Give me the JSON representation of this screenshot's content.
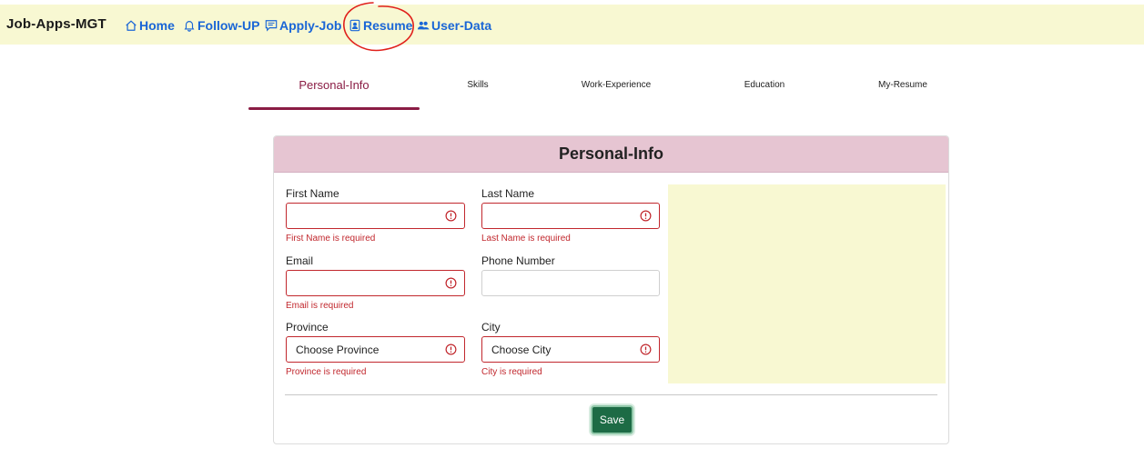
{
  "navbar": {
    "brand": "Job-Apps-MGT",
    "links": [
      {
        "label": "Home",
        "icon": "house-icon"
      },
      {
        "label": "Follow-UP",
        "icon": "bell-icon"
      },
      {
        "label": "Apply-Job",
        "icon": "chat-text-icon"
      },
      {
        "label": "Resume",
        "icon": "person-badge-icon"
      },
      {
        "label": "User-Data",
        "icon": "people-icon"
      }
    ],
    "link_color": "#1a66d6",
    "background": "#f8f8d2"
  },
  "annotation": {
    "color": "#e0201b",
    "target": "Resume"
  },
  "tabs": [
    {
      "label": "Personal-Info",
      "active": true
    },
    {
      "label": "Skills",
      "active": false
    },
    {
      "label": "Work-Experience",
      "active": false
    },
    {
      "label": "Education",
      "active": false
    },
    {
      "label": "My-Resume",
      "active": false
    }
  ],
  "form": {
    "title": "Personal-Info",
    "fields": {
      "first_name": {
        "label": "First Name",
        "value": "",
        "error": "First Name is required"
      },
      "last_name": {
        "label": "Last Name",
        "value": "",
        "error": "Last Name is required"
      },
      "email": {
        "label": "Email",
        "value": "",
        "error": "Email is required"
      },
      "phone": {
        "label": "Phone Number",
        "value": ""
      },
      "province": {
        "label": "Province",
        "value": "Choose Province",
        "error": "Province is required"
      },
      "city": {
        "label": "City",
        "value": "Choose City",
        "error": "City is required"
      }
    },
    "save_label": "Save",
    "colors": {
      "header": "#e6c5d2",
      "error": "#c1272d",
      "save": "#1d6b45",
      "active_tab": "#8a1c44"
    }
  }
}
